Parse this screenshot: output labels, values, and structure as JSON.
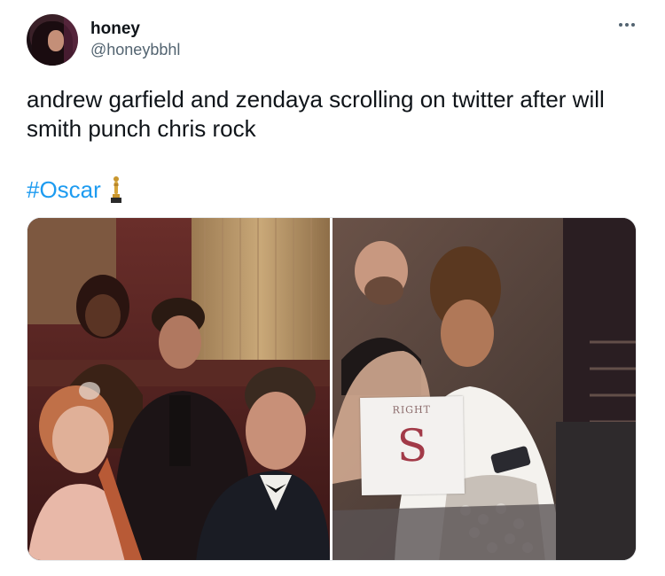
{
  "user": {
    "display_name": "honey",
    "handle": "@honeybbhl"
  },
  "tweet": {
    "text": "andrew garfield and zendaya scrolling on twitter after will smith punch chris rock",
    "hashtag": "#Oscar",
    "emoji_icon": "oscar-statuette-icon"
  },
  "menu": {
    "more_icon": "more-horizontal-icon"
  },
  "media": {
    "card_label": "RIGHT",
    "card_letter": "S"
  },
  "colors": {
    "link": "#1d9bf0",
    "secondary_text": "#536471",
    "primary_text": "#0f1419"
  }
}
